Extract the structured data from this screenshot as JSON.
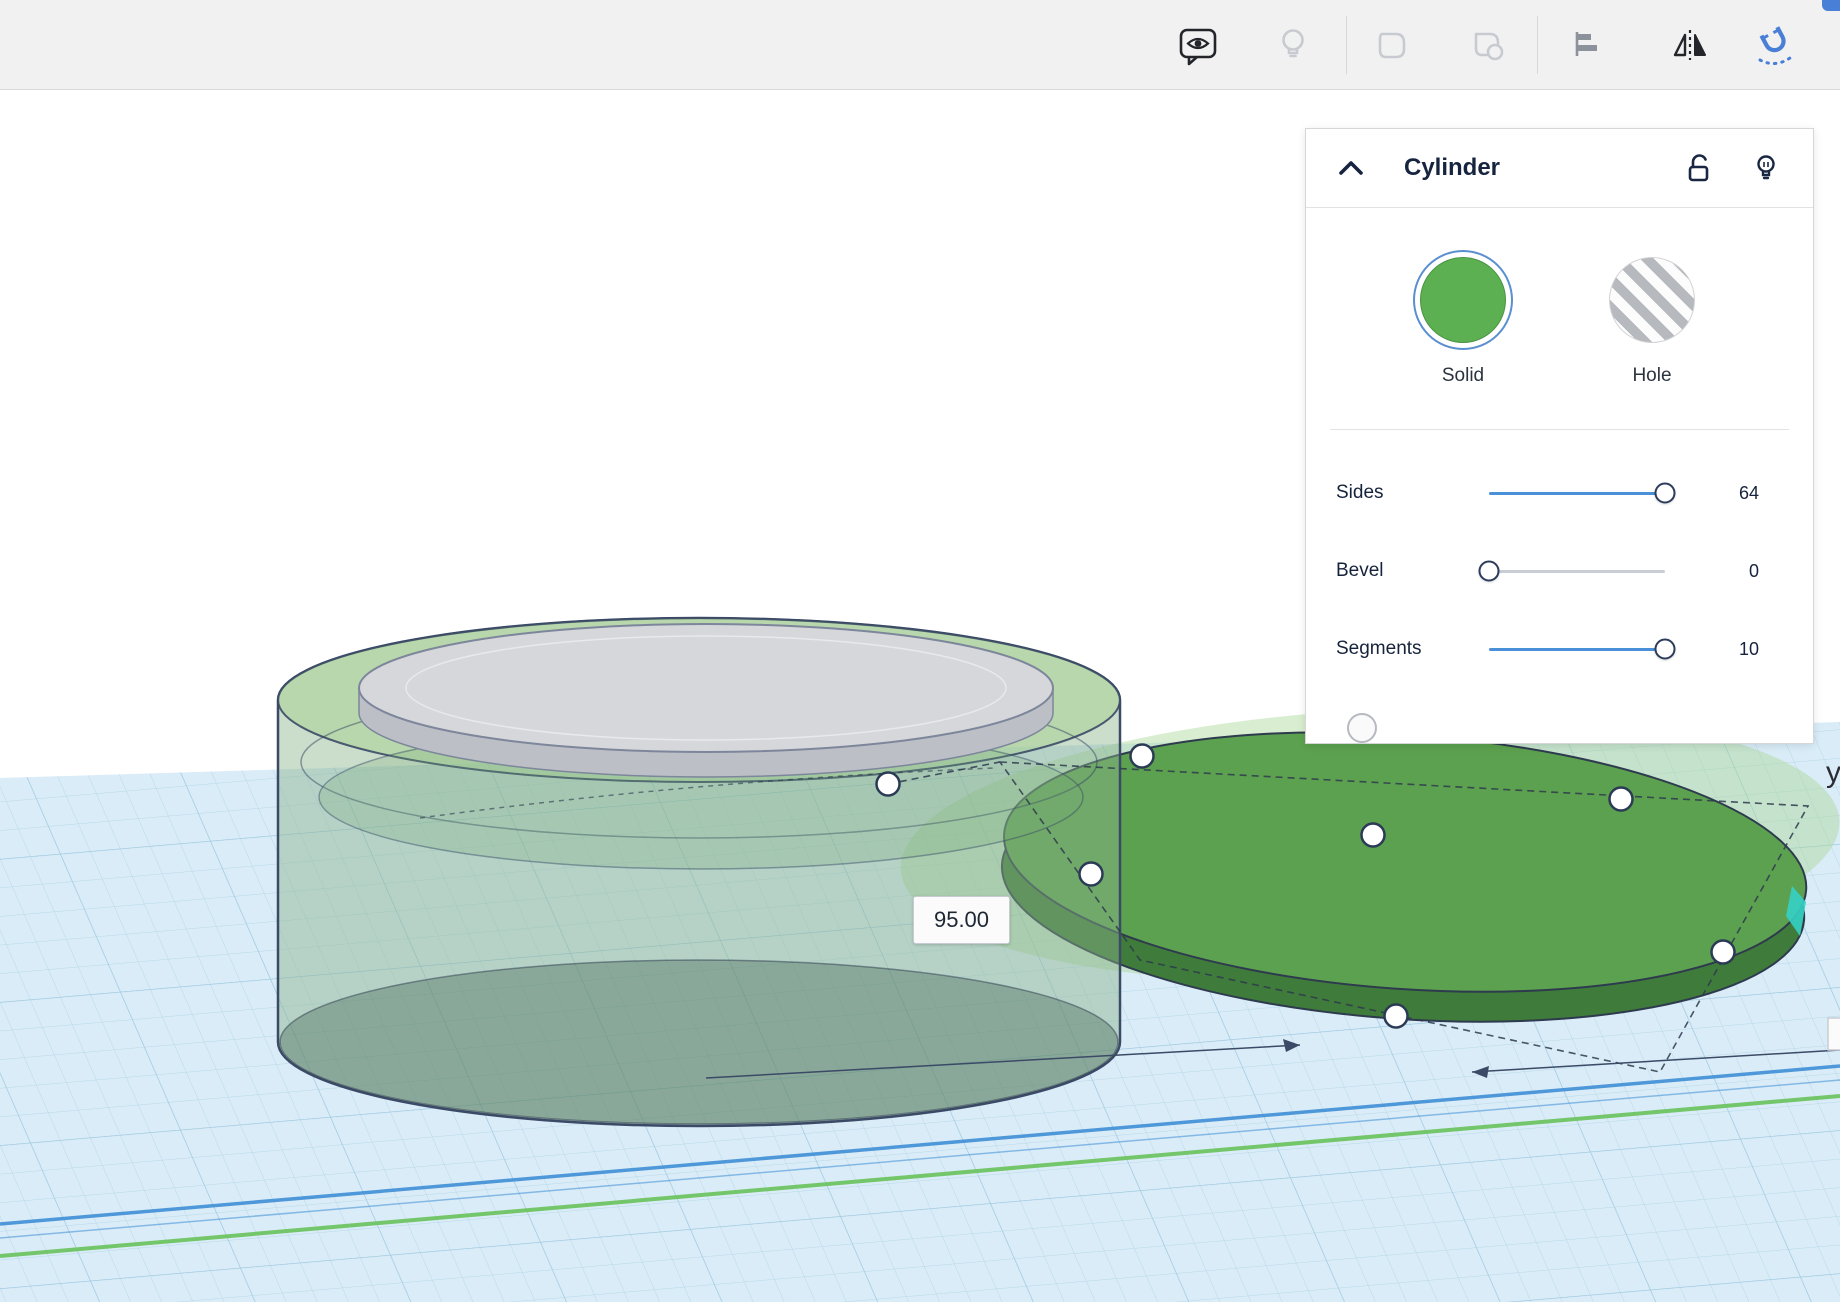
{
  "toolbar": {
    "icons": [
      {
        "name": "view-visibility-icon"
      },
      {
        "name": "lightbulb-icon"
      },
      {
        "name": "group-icon"
      },
      {
        "name": "ungroup-icon"
      },
      {
        "name": "align-icon"
      },
      {
        "name": "mirror-icon"
      },
      {
        "name": "snap-magnet-icon"
      }
    ]
  },
  "inspector": {
    "title": "Cylinder",
    "materials": [
      {
        "label": "Solid",
        "selected": true
      },
      {
        "label": "Hole",
        "selected": false
      }
    ],
    "params": [
      {
        "label": "Sides",
        "value": "64",
        "fraction": 1
      },
      {
        "label": "Bevel",
        "value": "0",
        "fraction": 0
      },
      {
        "label": "Segments",
        "value": "10",
        "fraction": 1
      }
    ]
  },
  "canvas": {
    "dimension_value": "95.00",
    "axis_label": "y"
  },
  "colors": {
    "accent_blue": "#4a90d9",
    "solid_green": "#5cb052",
    "disc_green": "#5ca14f",
    "magnet_blue": "#4a7fd8",
    "workplane_blue": "#d9ecf7",
    "outline_navy": "#2e3a4e"
  }
}
